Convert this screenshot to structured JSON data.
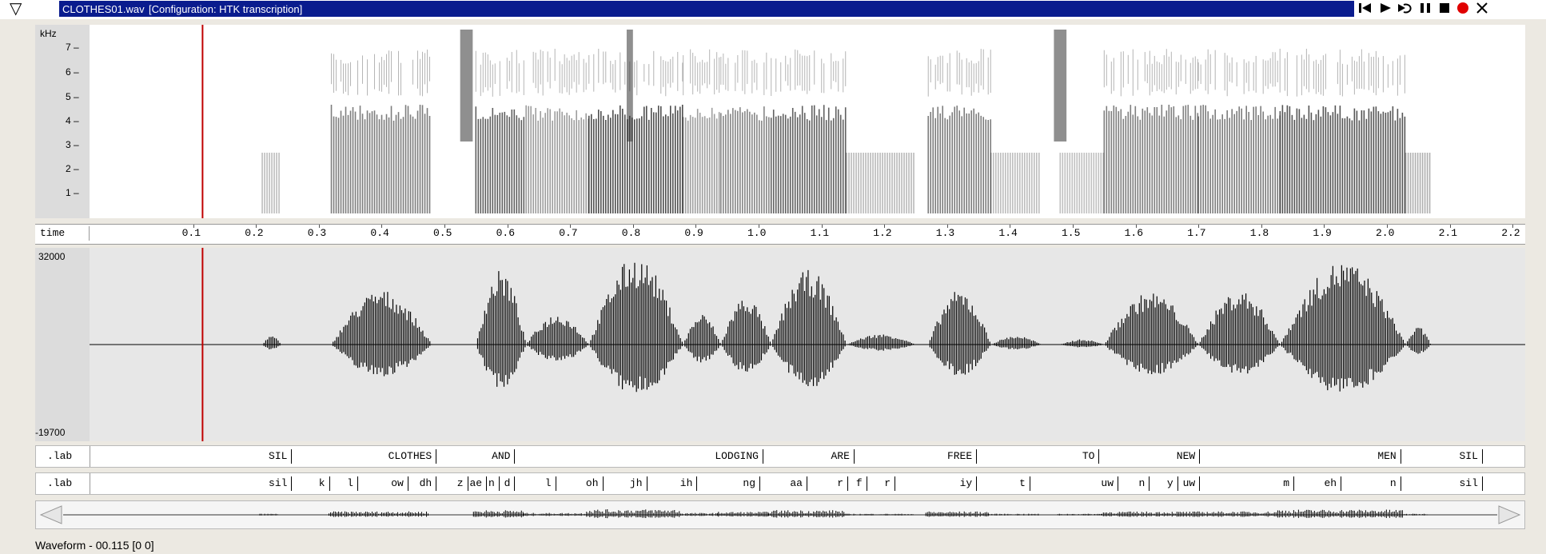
{
  "window": {
    "filename": "CLOTHES01.wav",
    "configuration": "[Configuration: HTK transcription]",
    "menu_icon": "triangle-down-icon",
    "controls": [
      "skip-back-icon",
      "play-icon",
      "play-loop-icon",
      "pause-icon",
      "stop-icon",
      "record-icon",
      "close-icon"
    ],
    "accent_color": "#0a1c8e",
    "record_color": "#e00000"
  },
  "spectrogram": {
    "unit_label": "kHz",
    "freq_ticks": [
      "7",
      "6",
      "5",
      "4",
      "3",
      "2",
      "1"
    ]
  },
  "time_axis": {
    "label": "time",
    "ticks": [
      "0.1",
      "0.2",
      "0.3",
      "0.4",
      "0.5",
      "0.6",
      "0.7",
      "0.8",
      "0.9",
      "1.0",
      "1.1",
      "1.2",
      "1.3",
      "1.4",
      "1.5",
      "1.6",
      "1.7",
      "1.8",
      "1.9",
      "2.0",
      "2.1",
      "2.2"
    ]
  },
  "waveform": {
    "max_label": "32000",
    "min_label": "-19700"
  },
  "word_tier": {
    "label": ".lab",
    "words": [
      "SIL",
      "CLOTHES",
      "AND",
      "LODGING",
      "ARE",
      "FREE",
      "TO",
      "NEW",
      "MEN",
      "SIL"
    ]
  },
  "phone_tier": {
    "label": ".lab",
    "phones": [
      "sil",
      "k",
      "l",
      "ow",
      "dh",
      "z",
      "ae",
      "n",
      "d",
      "l",
      "oh",
      "jh",
      "ih",
      "ng",
      "aa",
      "r",
      "f",
      "r",
      "iy",
      "t",
      "uw",
      "n",
      "y",
      "uw",
      "m",
      "eh",
      "n",
      "sil"
    ]
  },
  "status": {
    "text": "Waveform - 00.115 [0 0]"
  }
}
